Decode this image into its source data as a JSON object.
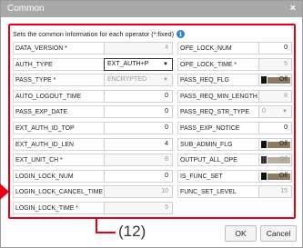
{
  "window": {
    "title": "Common",
    "close_glyph": "×"
  },
  "info": {
    "text": "Sets the common information for each operator (*:fixed)",
    "icon": "info-icon"
  },
  "left_fields": [
    {
      "label": "DATA_VERSION *",
      "value": "4",
      "kind": "text",
      "disabled": true
    },
    {
      "label": "AUTH_TYPE",
      "value": "EXT_AUTH+P",
      "kind": "select",
      "active": true
    },
    {
      "label": "PASS_TYPE *",
      "value": "ENCRYPTED",
      "kind": "select",
      "disabled": true
    },
    {
      "label": "AUTO_LOGOUT_TIME",
      "value": "0",
      "kind": "text"
    },
    {
      "label": "PASS_EXP_DATE",
      "value": "0",
      "kind": "text"
    },
    {
      "label": "EXT_AUTH_ID_TOP",
      "value": "0",
      "kind": "text"
    },
    {
      "label": "EXT_AUTH_ID_LEN",
      "value": "4",
      "kind": "text"
    },
    {
      "label": "EXT_UNIT_CH *",
      "value": "8",
      "kind": "text",
      "disabled": true
    },
    {
      "label": "LOGIN_LOCK_NUM",
      "value": "0",
      "kind": "text"
    },
    {
      "label": "LOGIN_LOCK_CANCEL_TIME",
      "value": "10",
      "kind": "text",
      "disabled": true
    },
    {
      "label": "LOGIN_LOCK_TIME *",
      "value": "5",
      "kind": "text",
      "disabled": true
    }
  ],
  "right_fields": [
    {
      "label": "OPE_LOCK_NUM",
      "value": "0",
      "kind": "text"
    },
    {
      "label": "OPE_LOCK_TIME *",
      "value": "5",
      "kind": "text",
      "disabled": true
    },
    {
      "label": "PASS_REQ_FLG",
      "value": "Off",
      "kind": "toggle"
    },
    {
      "label": "PASS_REQ_MIN_LENGTH",
      "value": "8",
      "kind": "text",
      "disabled": true
    },
    {
      "label": "PASS_REQ_STR_TYPE",
      "value": "0",
      "kind": "select",
      "disabled": true
    },
    {
      "label": "PASS_EXP_NOTICE",
      "value": "0",
      "kind": "text"
    },
    {
      "label": "SUB_ADMIN_FLG",
      "value": "Off",
      "kind": "toggle"
    },
    {
      "label": "OUTPUT_ALL_OPE",
      "value": "Off",
      "kind": "toggle",
      "disabled": true
    },
    {
      "label": "IS_FUNC_SET",
      "value": "Off",
      "kind": "toggle"
    },
    {
      "label": "FUNC_SET_LEVEL",
      "value": "15",
      "kind": "text",
      "disabled": true
    }
  ],
  "callout": {
    "label": "(12)"
  },
  "buttons": {
    "ok": "OK",
    "cancel": "Cancel"
  },
  "colors": {
    "highlight": "#e60012",
    "titlebar": "#a9a9a9",
    "info": "#2d7fd3"
  }
}
